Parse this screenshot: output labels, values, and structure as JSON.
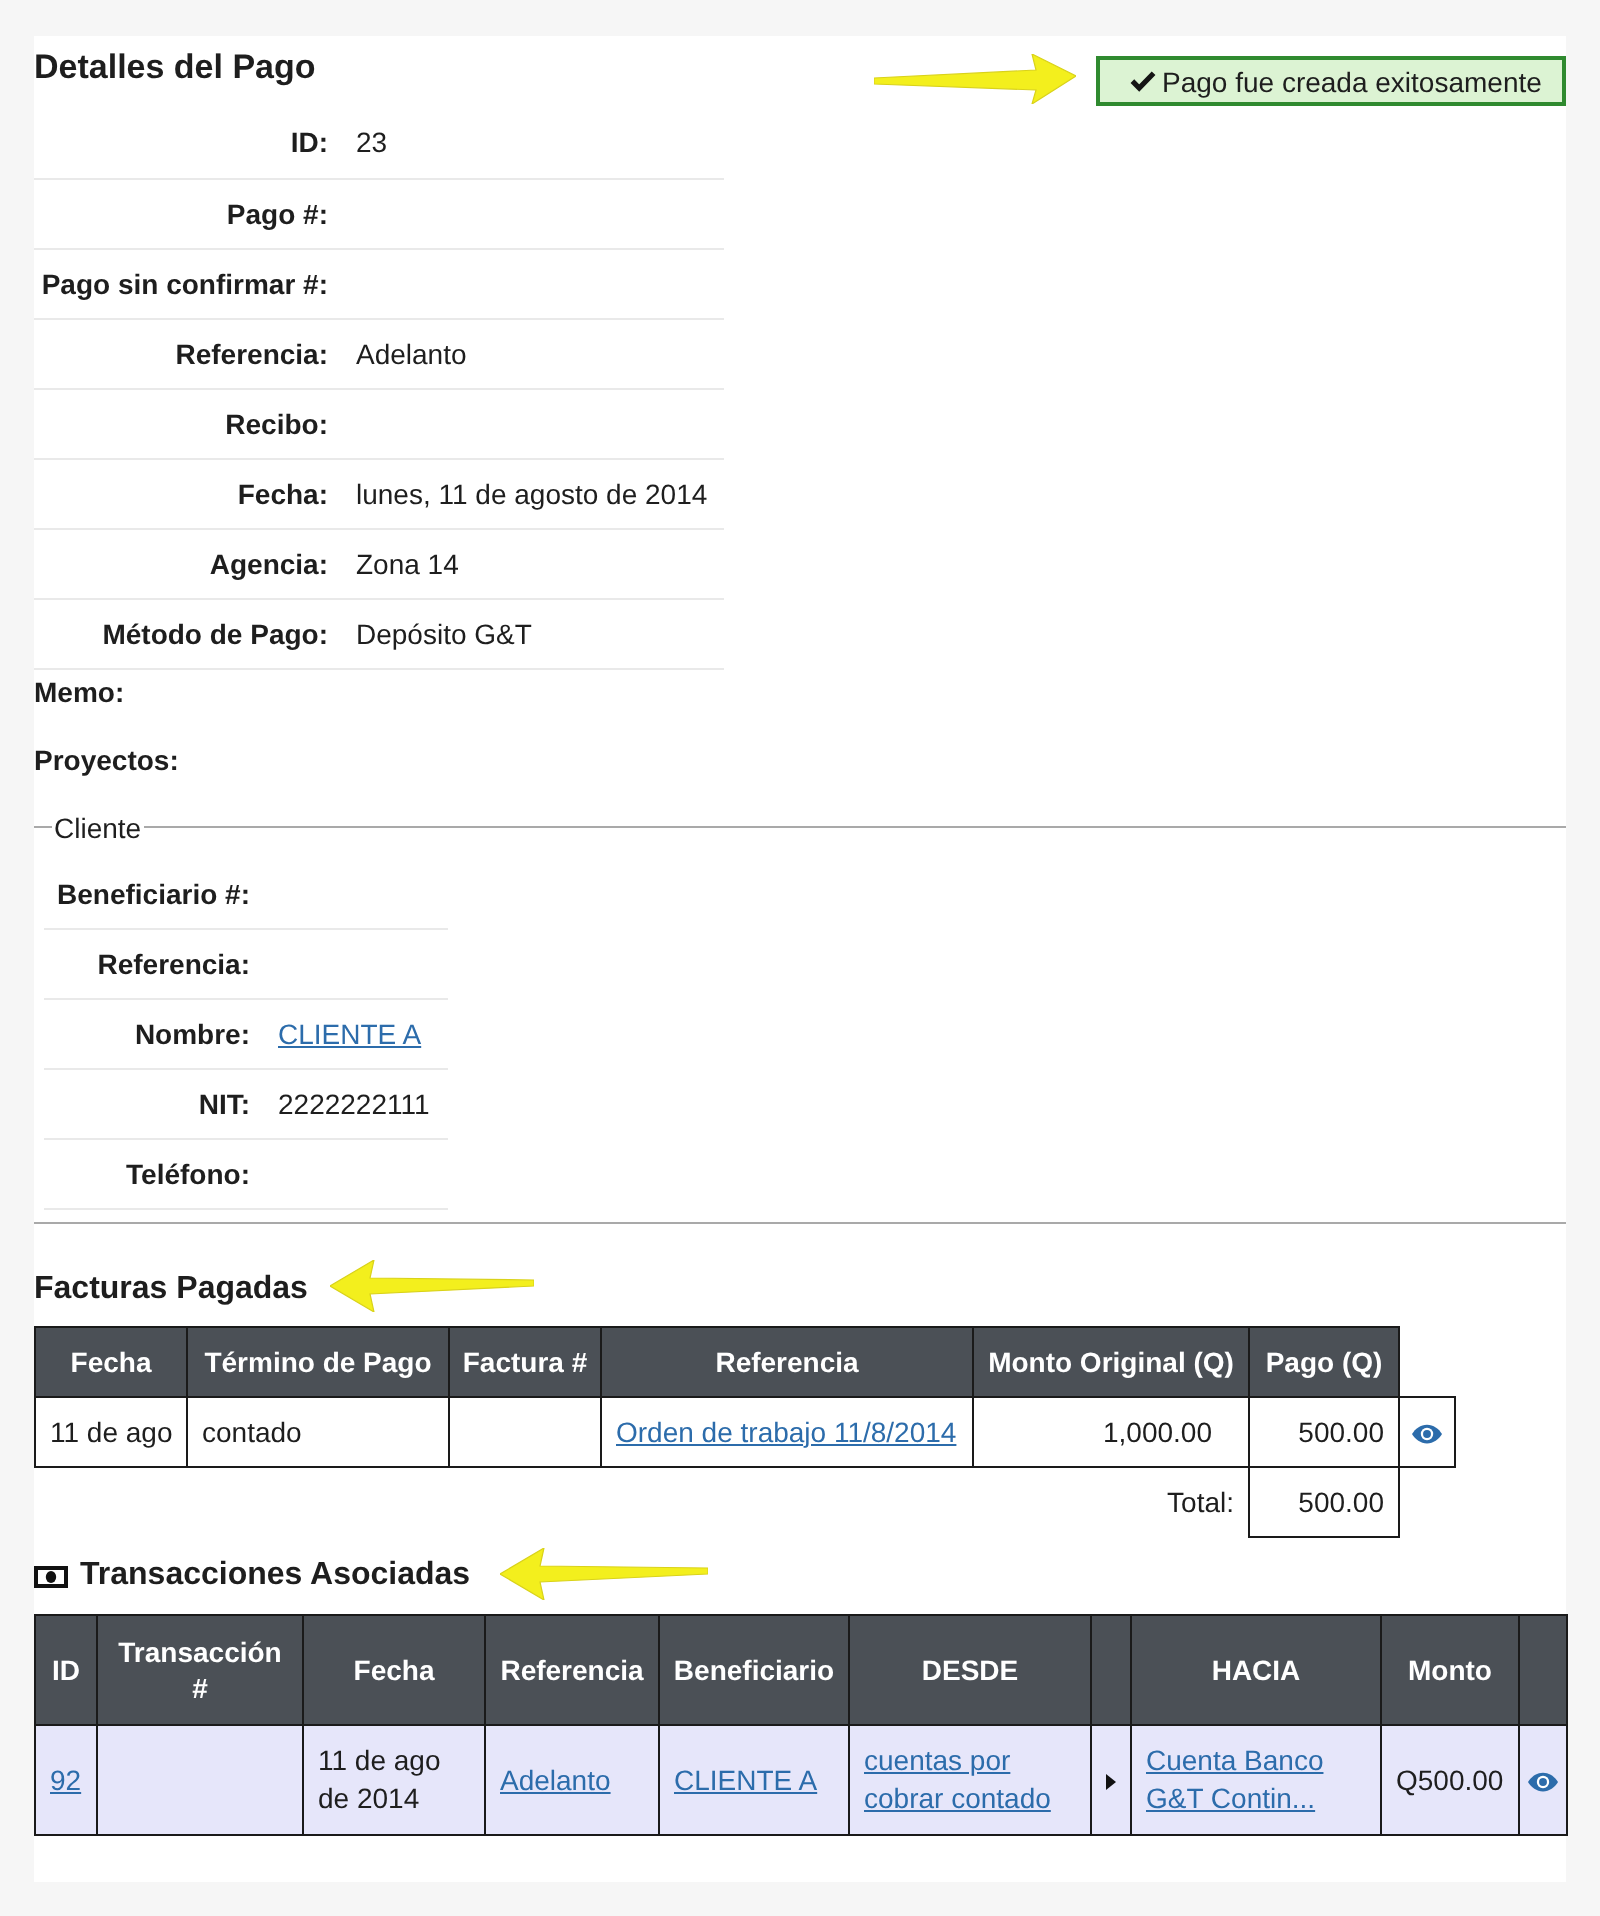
{
  "page_title": "Detalles del Pago",
  "alert": {
    "message": "Pago fue creada exitosamente"
  },
  "details": [
    {
      "label": "ID:",
      "value": "23"
    },
    {
      "label": "Pago #:"
    },
    {
      "label": "Pago sin confirmar #:"
    },
    {
      "label": "Referencia:",
      "value": "Adelanto"
    },
    {
      "label": "Recibo:"
    },
    {
      "label": "Fecha:",
      "value": "lunes, 11 de agosto de 2014"
    },
    {
      "label": "Agencia:",
      "value": "Zona 14"
    },
    {
      "label": "Método de Pago:",
      "value": "Depósito G&T"
    }
  ],
  "extra_fields": [
    {
      "label": "Memo:"
    },
    {
      "label": "Proyectos:"
    }
  ],
  "cliente": {
    "legend": "Cliente",
    "fields": [
      {
        "label": "Beneficiario #:"
      },
      {
        "label": "Referencia:"
      },
      {
        "label": "Nombre:",
        "value": "CLIENTE A",
        "kind": "link"
      },
      {
        "label": "NIT:",
        "value": "2222222111",
        "kind": "text"
      },
      {
        "label": "Teléfono:"
      }
    ]
  },
  "facturas": {
    "title": "Facturas Pagadas",
    "columns": [
      "Fecha",
      "Término de Pago",
      "Factura #",
      "Referencia",
      "Monto Original (Q)",
      "Pago (Q)"
    ],
    "rows": [
      {
        "fecha": "11 de ago",
        "termino": "contado",
        "referencia": "Orden de trabajo 11/8/2014",
        "monto_original": "1,000.00",
        "pago": "500.00"
      }
    ],
    "total_label": "Total:",
    "total": "500.00"
  },
  "transacciones": {
    "title": "Transacciones Asociadas",
    "columns": [
      "ID",
      "Transacción #",
      "Fecha",
      "Referencia",
      "Beneficiario",
      "DESDE",
      "HACIA",
      "Monto"
    ],
    "rows": [
      {
        "id": "92",
        "fecha": "11 de ago de 2014",
        "referencia": "Adelanto",
        "beneficiario": "CLIENTE A",
        "desde": "cuentas por cobrar contado",
        "hacia": "Cuenta Banco G&T Contin...",
        "monto": "Q500.00"
      }
    ]
  }
}
